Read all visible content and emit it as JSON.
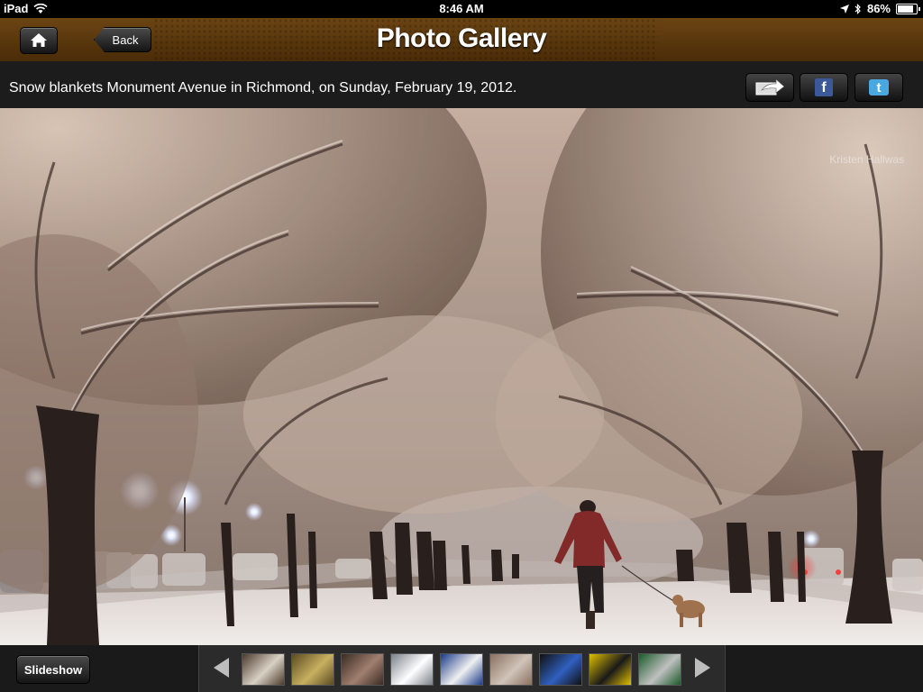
{
  "status_bar": {
    "device": "iPad",
    "time": "8:46 AM",
    "battery": "86%",
    "battery_level": 0.86
  },
  "header": {
    "title": "Photo Gallery",
    "back_label": "Back"
  },
  "caption": {
    "text": "Snow blankets Monument Avenue in Richmond, on Sunday, February 19, 2012."
  },
  "photo": {
    "credit": "Kristen Hallwas"
  },
  "share": {
    "facebook_glyph": "f",
    "twitter_glyph": "t"
  },
  "bottom": {
    "slideshow_label": "Slideshow",
    "thumbnails": [
      {
        "colors": [
          "#4a3a2c",
          "#d9d0c4"
        ],
        "icon": "crowd-photo"
      },
      {
        "colors": [
          "#5a4a20",
          "#c8b060"
        ],
        "icon": "band-photo"
      },
      {
        "colors": [
          "#3a2a22",
          "#a08070"
        ],
        "icon": "group-photo"
      },
      {
        "colors": [
          "#7a8088",
          "#ffffff"
        ],
        "icon": "car-snow-photo"
      },
      {
        "colors": [
          "#1a3a8a",
          "#f0f0f0"
        ],
        "icon": "sledding-photo"
      },
      {
        "colors": [
          "#8a7060",
          "#d0c4b8"
        ],
        "icon": "snowy-street-photo"
      },
      {
        "colors": [
          "#101010",
          "#3060c0"
        ],
        "icon": "basketball-photo"
      },
      {
        "colors": [
          "#e0c000",
          "#1a1a1a"
        ],
        "icon": "sports-action-photo"
      },
      {
        "colors": [
          "#1a5a2a",
          "#c0c0c0"
        ],
        "icon": "team-photo"
      }
    ]
  }
}
